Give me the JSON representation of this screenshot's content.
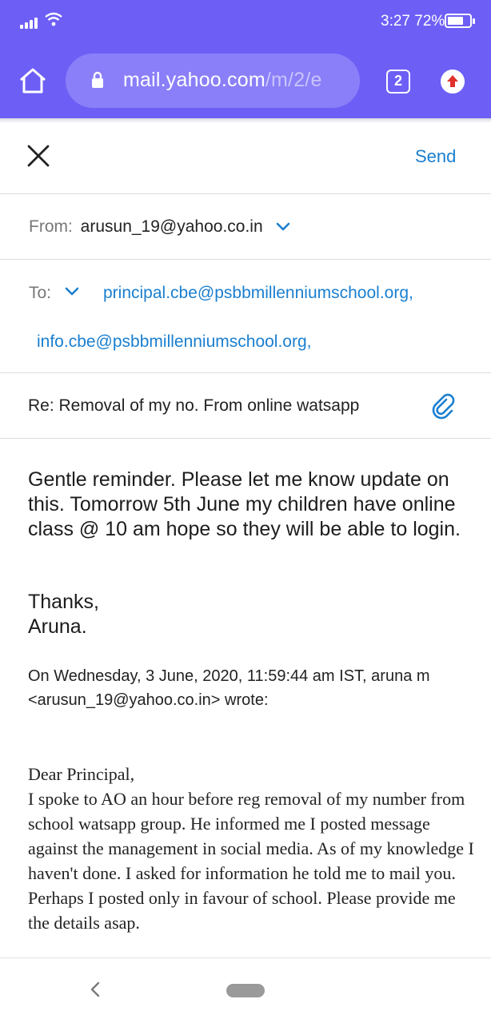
{
  "status_bar": {
    "time": "3:27",
    "battery": "72%",
    "battery_level": 0.72,
    "icons": [
      "signal-icon",
      "wifi-icon",
      "battery-icon"
    ]
  },
  "browser": {
    "url_host": "mail.yahoo.com",
    "url_path": "/m/2/e",
    "tab_count": "2",
    "icons": [
      "home-icon",
      "lock-icon",
      "tabs-icon",
      "update-icon"
    ]
  },
  "compose": {
    "send_label": "Send",
    "from_label": "From:",
    "from_value": "arusun_19@yahoo.co.in",
    "to_label": "To:",
    "recipients": [
      "principal.cbe@psbbmillenniumschool.org,",
      "info.cbe@psbbmillenniumschool.org,"
    ],
    "subject": "Re: Removal of my no. From online watsapp"
  },
  "message": {
    "body": "Gentle reminder. Please let me know update on this. Tomorrow 5th June my children have online class @ 10 am hope so they will be able to login.",
    "thanks": "Thanks,",
    "signature": "Aruna.",
    "quote_header_line1": "On Wednesday, 3 June, 2020, 11:59:44 am IST, aruna m",
    "quote_header_line2": "<arusun_19@yahoo.co.in> wrote:",
    "quoted_greeting": "Dear Principal,",
    "quoted_text": "I spoke to AO an hour before reg removal of my number from school watsapp group. He informed me I posted message against the management in social media. As of my knowledge I haven't done. I asked for information he told me to mail you. Perhaps I posted only in favour of school. Please provide me the details asap."
  },
  "colors": {
    "chrome": "#6d5ff5",
    "url_bar": "#8a7ff8",
    "link": "#1a7fd0",
    "update_badge": "#e0312b"
  }
}
